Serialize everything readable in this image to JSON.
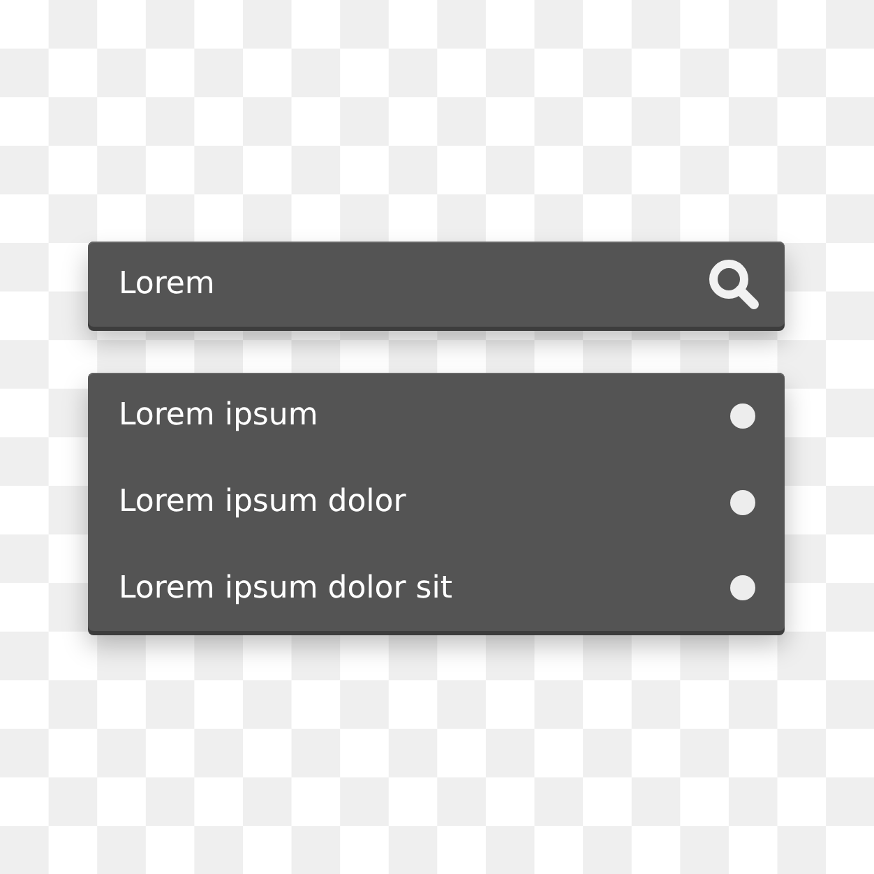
{
  "search": {
    "value": "Lorem"
  },
  "results": [
    {
      "label": "Lorem ipsum"
    },
    {
      "label": "Lorem ipsum dolor"
    },
    {
      "label": "Lorem ipsum dolor sit"
    }
  ]
}
